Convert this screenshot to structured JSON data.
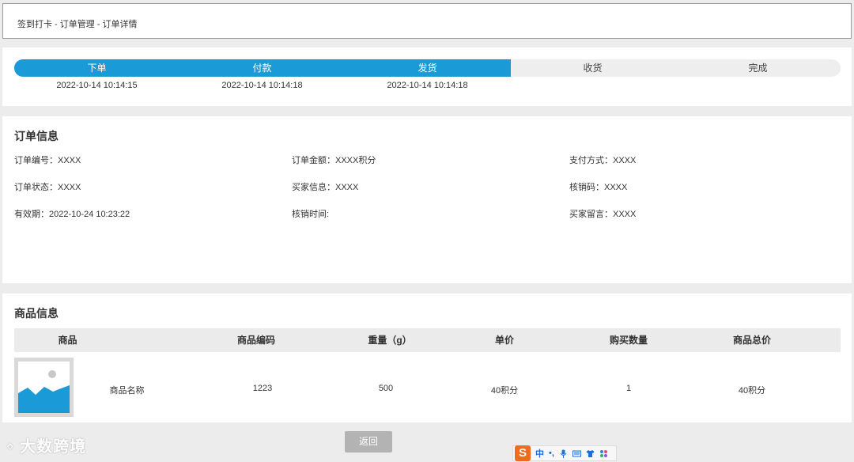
{
  "breadcrumb": "签到打卡 - 订单管理 - 订单详情",
  "steps": [
    {
      "label": "下单",
      "time": "2022-10-14 10:14:15",
      "done": true
    },
    {
      "label": "付款",
      "time": "2022-10-14 10:14:18",
      "done": true
    },
    {
      "label": "发货",
      "time": "2022-10-14 10:14:18",
      "done": true
    },
    {
      "label": "收货",
      "time": "",
      "done": false
    },
    {
      "label": "完成",
      "time": "",
      "done": false
    }
  ],
  "order_info": {
    "title": "订单信息",
    "order_no": "订单编号：XXXX",
    "amount": "订单金额：XXXX积分",
    "pay_method": "支付方式：XXXX",
    "status": "订单状态：XXXX",
    "buyer": "买家信息：XXXX",
    "verify_code": "核销码：XXXX",
    "valid_until": "有效期：2022-10-24 10:23:22",
    "verify_time": "核销时间:",
    "buyer_note": "买家留言：XXXX"
  },
  "goods_info": {
    "title": "商品信息",
    "columns": [
      "商品",
      "商品编码",
      "重量（g）",
      "单价",
      "购买数量",
      "商品总价"
    ],
    "rows": [
      {
        "name": "商品名称",
        "code": "1223",
        "weight": "500",
        "price": "40积分",
        "qty": "1",
        "total": "40积分"
      }
    ]
  },
  "back_button": "返回",
  "watermark": "大数跨境",
  "ime": {
    "mode": "中",
    "punct": "•,"
  },
  "colors": {
    "accent": "#1a9bd7",
    "track": "#eeeeee",
    "button": "#b3b3b3"
  },
  "icons": [
    "image-placeholder-icon",
    "sogou-ime-icon",
    "microphone-icon",
    "keyboard-icon",
    "shirt-icon",
    "grid-icon"
  ]
}
